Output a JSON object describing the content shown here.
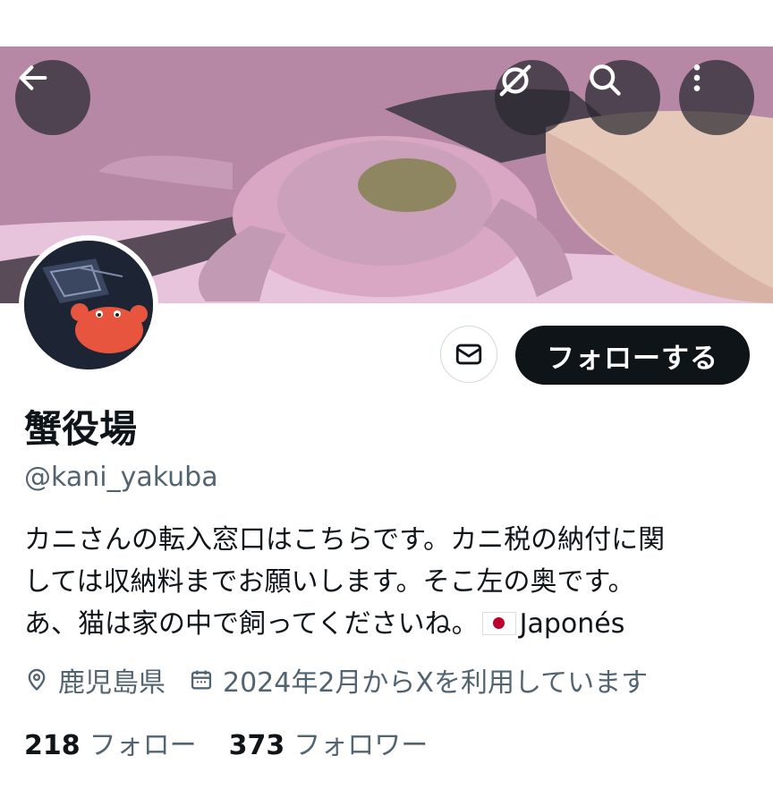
{
  "header": {
    "back_icon": "arrow-left-icon",
    "grok_icon": "grok-icon",
    "search_icon": "search-icon",
    "more_icon": "more-vertical-icon"
  },
  "profile": {
    "name": "蟹役場",
    "handle": "@kani_yakuba",
    "bio_lines": [
      "カニさんの転入窓口はこちらです。カニ税の納付に関",
      "しては収納料までお願いします。そこ左の奥です。",
      "あ、猫は家の中で飼ってくださいね。"
    ],
    "translate_label": "Japonés",
    "location": "鹿児島県",
    "joined": "2024年2月からXを利用しています",
    "following_count": "218",
    "following_label": "フォロー",
    "followers_count": "373",
    "followers_label": "フォロワー"
  },
  "actions": {
    "message_icon": "envelope-icon",
    "follow_label": "フォローする"
  },
  "colors": {
    "text": "#0f1419",
    "secondary": "#536471",
    "follow_bg": "#0f1419",
    "banner_tint": "#c795b8"
  }
}
